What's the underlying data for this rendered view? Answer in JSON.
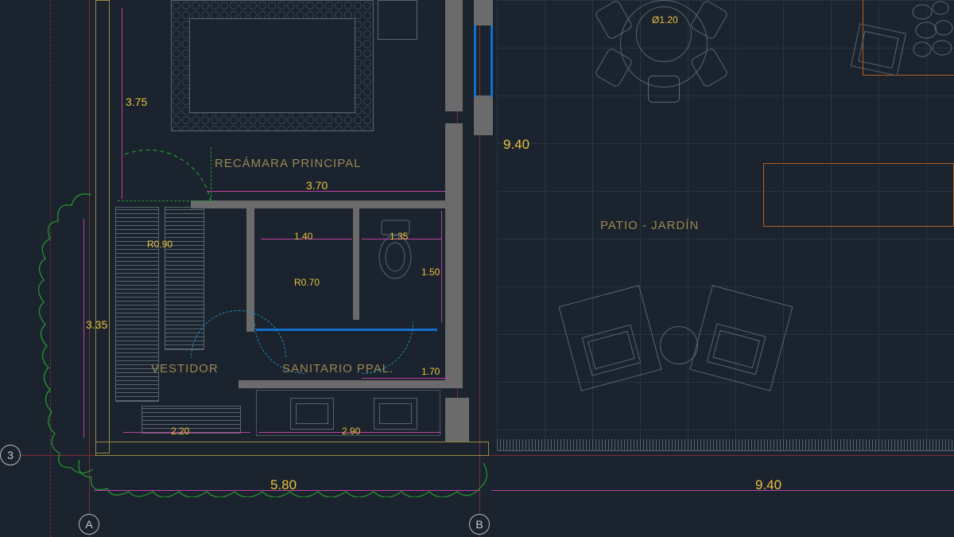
{
  "grid_bubbles": {
    "row": "3",
    "colA": "A",
    "colB": "B"
  },
  "rooms": {
    "recamara": "RECÁMARA PRINCIPAL",
    "vestidor": "VESTIDOR",
    "sanitario": "SANITARIO PPAL.",
    "patio": "PATIO - JARDÍN"
  },
  "dimensions": {
    "table_dia": "Ø1.20",
    "h_9_40_right": "9.40",
    "h_9_40_bottom": "9.40",
    "h_5_80": "5.80",
    "v_3_75": "3.75",
    "v_3_35": "3.35",
    "h_3_70": "3.70",
    "h_1_40": "1.40",
    "h_1_35": "1.35",
    "v_1_50": "1.50",
    "h_1_70": "1.70",
    "h_2_20": "2.20",
    "h_2_90": "2.90",
    "r_0_90": "R0.90",
    "r_0_70": "R0.70"
  },
  "colors": {
    "bg": "#1a232e",
    "dim": "#e8c040",
    "axis": "#803030",
    "dimline": "#c040a0",
    "wall": "#6b6b6b",
    "furn": "#5a6570",
    "shrub": "#2a9030",
    "door": "#2090c0"
  }
}
